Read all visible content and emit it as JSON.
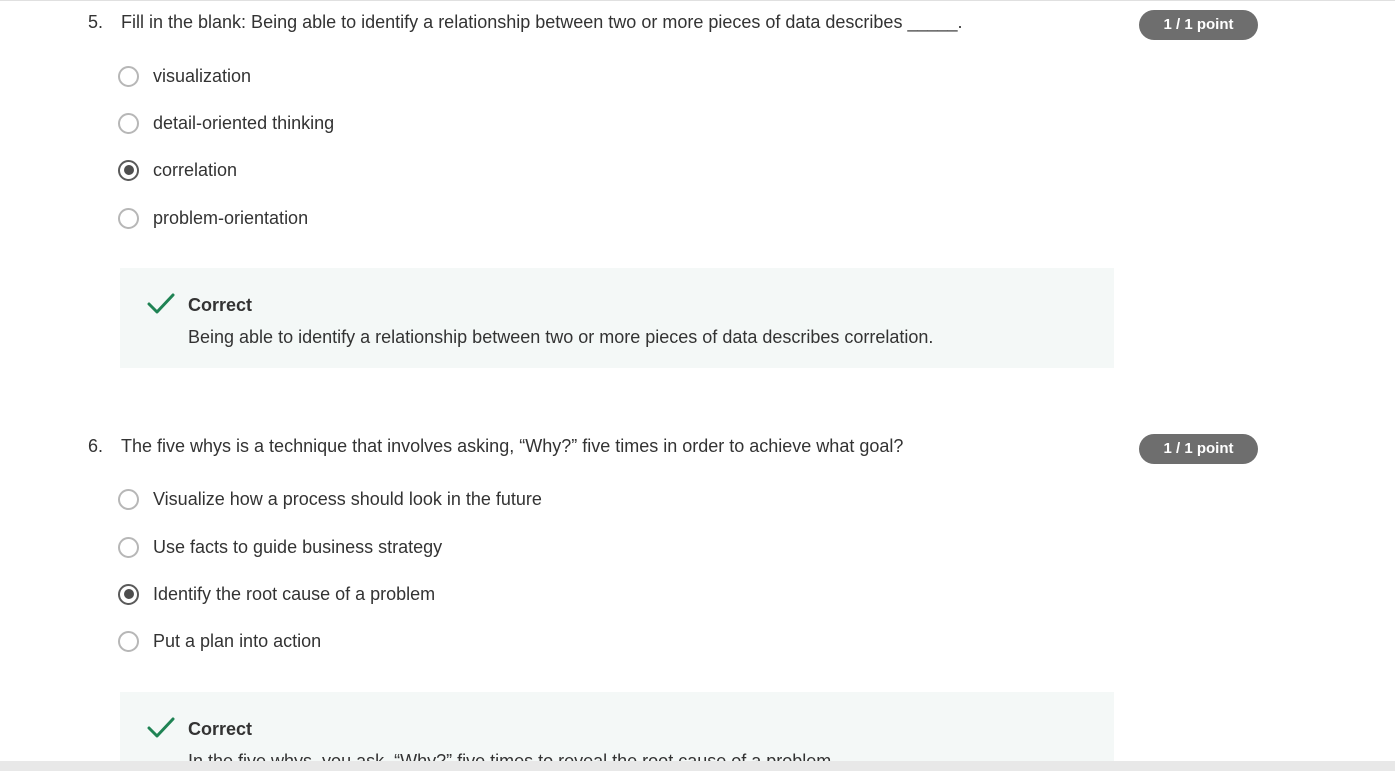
{
  "questions": [
    {
      "number": "5.",
      "text": "Fill in the blank: Being able to identify a relationship between two or more pieces of data describes _____.",
      "points": "1 / 1 point",
      "options": [
        {
          "label": "visualization",
          "selected": false
        },
        {
          "label": "detail-oriented thinking",
          "selected": false
        },
        {
          "label": "correlation",
          "selected": true
        },
        {
          "label": "problem-orientation",
          "selected": false
        }
      ],
      "feedback": {
        "status": "Correct",
        "explanation": "Being able to identify a relationship between two or more pieces of data describes correlation."
      }
    },
    {
      "number": "6.",
      "text": "The five whys is a technique that involves asking, “Why?” five times in order to achieve what goal?",
      "points": "1 / 1 point",
      "options": [
        {
          "label": "Visualize how a process should look in the future",
          "selected": false
        },
        {
          "label": "Use facts to guide business strategy",
          "selected": false
        },
        {
          "label": "Identify the root cause of a problem",
          "selected": true
        },
        {
          "label": "Put a plan into action",
          "selected": false
        }
      ],
      "feedback": {
        "status": "Correct",
        "explanation": "In the five whys, you ask, “Why?” five times to reveal the root cause of a problem."
      }
    }
  ],
  "colors": {
    "badge": "#6e6e6e",
    "check": "#1f8354",
    "feedback_bg": "#f4f8f7"
  },
  "icons": {
    "check": "checkmark-icon"
  }
}
